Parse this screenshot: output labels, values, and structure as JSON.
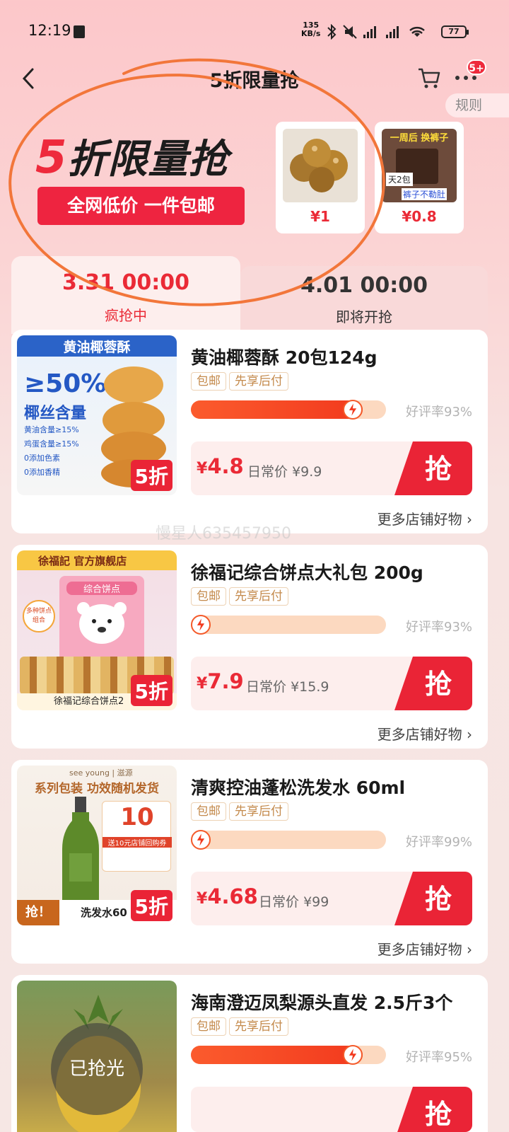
{
  "status_bar": {
    "time": "12:19",
    "speed_value": "135",
    "speed_unit": "KB/s",
    "battery": "77"
  },
  "nav": {
    "title": "5折限量抢",
    "cart_icon": "cart-icon",
    "more_badge": "5+",
    "rules": "规则"
  },
  "banner": {
    "heading_accent": "5",
    "heading_rest": "折限量抢",
    "tagline": "全网低价 一件包邮",
    "mini_products": [
      {
        "price": "¥1"
      },
      {
        "price": "¥0.8",
        "label_top": "一周后 换裤子",
        "label_bottom": "裤子不勒肚",
        "label_side": "天2包"
      }
    ]
  },
  "tabs": [
    {
      "time": "3.31 00:00",
      "status": "疯抢中",
      "active": true
    },
    {
      "time": "4.01 00:00",
      "status": "即将开抢",
      "active": false
    }
  ],
  "products": [
    {
      "title": "黄油椰蓉酥 20包124g",
      "tags": [
        "包邮",
        "先享后付"
      ],
      "progress": 0.88,
      "rating": "好评率93%",
      "price_yen": "¥",
      "price": "4.8",
      "daily_label": "日常价",
      "daily_price": "¥9.9",
      "grab": "抢",
      "more_shop": "更多店铺好物",
      "image": {
        "banner": "黄油椰蓉酥",
        "big": "≥50%",
        "sub": "椰丝含量",
        "list": [
          "黄油含量≥15%",
          "鸡蛋含量≥15%",
          "0添加色素",
          "0添加香精"
        ],
        "discount": "5折"
      }
    },
    {
      "title": "徐福记综合饼点大礼包 200g",
      "tags": [
        "包邮",
        "先享后付"
      ],
      "progress": 0.0,
      "rating": "好评率93%",
      "price_yen": "¥",
      "price": "7.9",
      "daily_label": "日常价",
      "daily_price": "¥15.9",
      "grab": "抢",
      "more_shop": "更多店铺好物",
      "image": {
        "banner": "徐福記 官方旗舰店",
        "bag": "综合饼点",
        "badge": "多种饼点组合",
        "caption": "徐福记综合饼点2",
        "discount": "5折"
      }
    },
    {
      "title": "清爽控油蓬松洗发水 60ml",
      "tags": [
        "包邮",
        "先享后付"
      ],
      "progress": 0.0,
      "rating": "好评率99%",
      "price_yen": "¥",
      "price": "4.68",
      "daily_label": "日常价",
      "daily_price": "¥99",
      "grab": "抢",
      "more_shop": "更多店铺好物",
      "image": {
        "brand": "see young | 滋源",
        "headline": "系列包装 功效随机发货",
        "coupon": "10",
        "coupon_note": "送10元店铺回购券",
        "grab": "抢！",
        "caption": "洗发水60",
        "discount": "5折"
      }
    },
    {
      "title": "海南澄迈凤梨源头直发 2.5斤3个",
      "tags": [
        "包邮",
        "先享后付"
      ],
      "progress": 0.88,
      "rating": "好评率95%",
      "sold_out": "已抢光",
      "grab": "抢"
    }
  ],
  "watermark": "慢星人635457950",
  "colors": {
    "accent": "#ea2a36",
    "progress": "#f4511e",
    "tag": "#c48a4c"
  }
}
